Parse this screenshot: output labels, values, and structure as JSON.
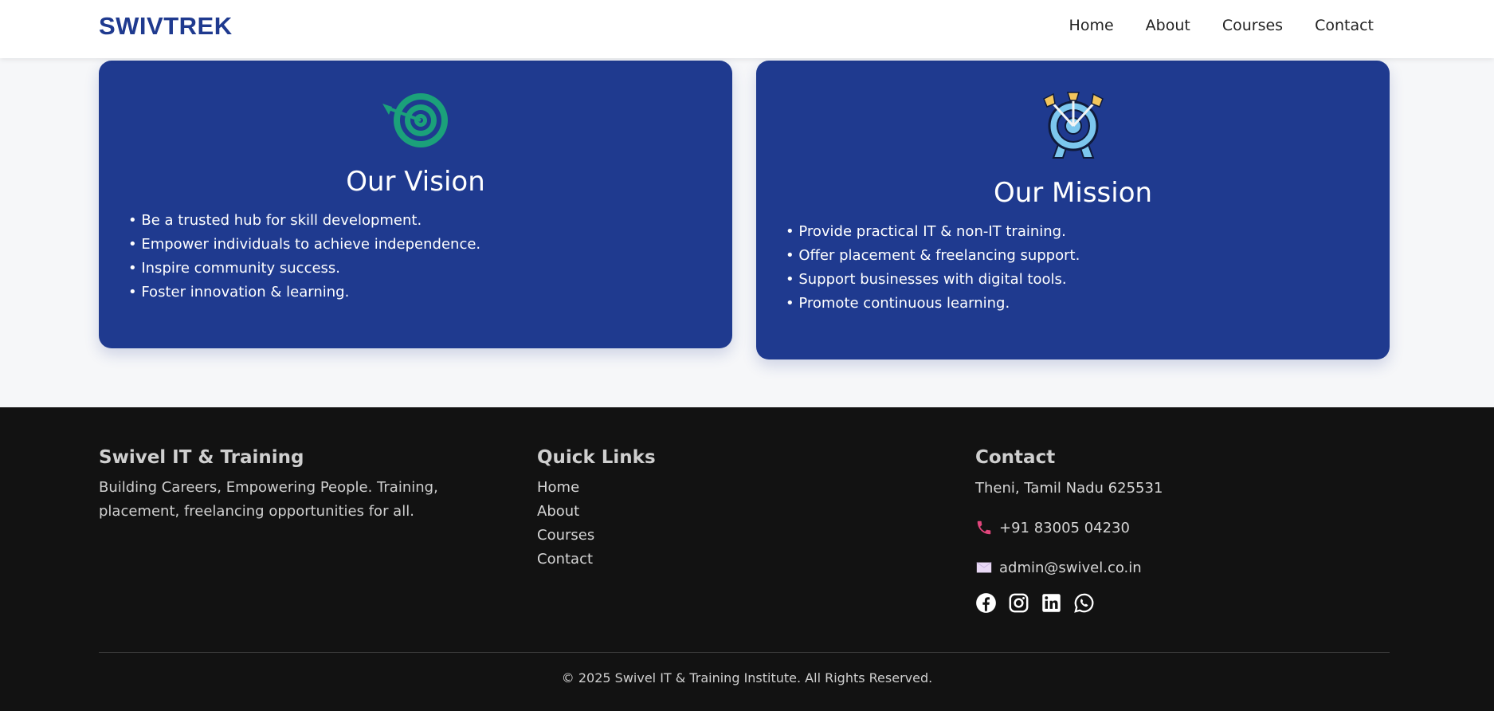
{
  "header": {
    "brand": "SWIVTREK",
    "nav": [
      {
        "label": "Home"
      },
      {
        "label": "About"
      },
      {
        "label": "Courses"
      },
      {
        "label": "Contact"
      }
    ]
  },
  "vision": {
    "icon": "target-icon",
    "title": "Our Vision",
    "items": [
      "Be a trusted hub for skill development.",
      "Empower individuals to achieve independence.",
      "Inspire community success.",
      "Foster innovation & learning."
    ]
  },
  "mission": {
    "icon": "archery-target-icon",
    "title": "Our Mission",
    "items": [
      "Provide practical IT & non-IT training.",
      "Offer placement & freelancing support.",
      "Support businesses with digital tools.",
      "Promote continuous learning."
    ]
  },
  "footer": {
    "about": {
      "title": "Swivel IT & Training",
      "description": "Building Careers, Empowering People. Training, placement, freelancing opportunities for all."
    },
    "quick_links": {
      "title": "Quick Links",
      "items": [
        "Home",
        "About",
        "Courses",
        "Contact"
      ]
    },
    "contact": {
      "title": "Contact",
      "address": "Theni, Tamil Nadu 625531",
      "phone": "+91 83005 04230",
      "email": "admin@swivel.co.in",
      "socials": [
        "facebook-icon",
        "instagram-icon",
        "linkedin-icon",
        "whatsapp-icon"
      ]
    },
    "copyright": "© 2025 Swivel IT & Training Institute. All Rights Reserved."
  },
  "colors": {
    "brand": "#1f3a8f",
    "card_bg": "#1f3a8f",
    "footer_bg": "#121212",
    "phone_icon": "#e0457b"
  }
}
